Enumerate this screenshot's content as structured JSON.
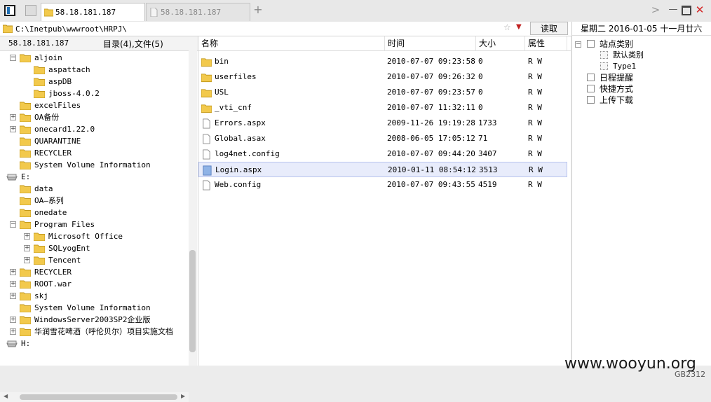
{
  "tabs": [
    {
      "label": "58.18.181.187",
      "active": true
    },
    {
      "label": "58.18.181.187",
      "active": false
    }
  ],
  "address": {
    "path": "C:\\Inetpub\\wwwroot\\HRPJ\\",
    "read_label": "读取",
    "star": "☆"
  },
  "left_header": {
    "host": "58.18.181.187",
    "summary": "目录(4),文件(5)"
  },
  "tree": [
    {
      "label": "aljoin",
      "level": 1,
      "exp": "-",
      "type": "folder"
    },
    {
      "label": "aspattach",
      "level": 2,
      "exp": "",
      "type": "folder"
    },
    {
      "label": "aspDB",
      "level": 2,
      "exp": "",
      "type": "folder"
    },
    {
      "label": "jboss-4.0.2",
      "level": 2,
      "exp": "",
      "type": "folder"
    },
    {
      "label": "excelFiles",
      "level": 1,
      "exp": "",
      "type": "folder"
    },
    {
      "label": "OA备份",
      "level": 1,
      "exp": "+",
      "type": "folder"
    },
    {
      "label": "onecard1.22.0",
      "level": 1,
      "exp": "+",
      "type": "folder"
    },
    {
      "label": "QUARANTINE",
      "level": 1,
      "exp": "",
      "type": "folder"
    },
    {
      "label": "RECYCLER",
      "level": 1,
      "exp": "",
      "type": "folder"
    },
    {
      "label": "System Volume Information",
      "level": 1,
      "exp": "",
      "type": "folder"
    },
    {
      "label": "E:",
      "level": 0,
      "exp": "",
      "type": "drive"
    },
    {
      "label": "data",
      "level": 1,
      "exp": "",
      "type": "folder"
    },
    {
      "label": "OA—系列",
      "level": 1,
      "exp": "",
      "type": "folder"
    },
    {
      "label": "onedate",
      "level": 1,
      "exp": "",
      "type": "folder"
    },
    {
      "label": "Program Files",
      "level": 1,
      "exp": "-",
      "type": "folder"
    },
    {
      "label": "Microsoft Office",
      "level": 2,
      "exp": "+",
      "type": "folder"
    },
    {
      "label": "SQLyogEnt",
      "level": 2,
      "exp": "+",
      "type": "folder"
    },
    {
      "label": "Tencent",
      "level": 2,
      "exp": "+",
      "type": "folder"
    },
    {
      "label": "RECYCLER",
      "level": 1,
      "exp": "+",
      "type": "folder"
    },
    {
      "label": "ROOT.war",
      "level": 1,
      "exp": "+",
      "type": "folder"
    },
    {
      "label": "skj",
      "level": 1,
      "exp": "+",
      "type": "folder"
    },
    {
      "label": "System Volume Information",
      "level": 1,
      "exp": "",
      "type": "folder"
    },
    {
      "label": "WindowsServer2003SP2企业版",
      "level": 1,
      "exp": "+",
      "type": "folder"
    },
    {
      "label": "华润雪花啤酒（呼伦贝尔）项目实施文档",
      "level": 1,
      "exp": "+",
      "type": "folder"
    },
    {
      "label": "H:",
      "level": 0,
      "exp": "",
      "type": "drive"
    }
  ],
  "columns": {
    "name": "名称",
    "time": "时间",
    "size": "大小",
    "attr": "属性"
  },
  "files": [
    {
      "name": "bin",
      "time": "2010-07-07 09:23:58",
      "size": "0",
      "attr": "R W",
      "type": "folder"
    },
    {
      "name": "userfiles",
      "time": "2010-07-07 09:26:32",
      "size": "0",
      "attr": "R W",
      "type": "folder"
    },
    {
      "name": "USL",
      "time": "2010-07-07 09:23:57",
      "size": "0",
      "attr": "R W",
      "type": "folder"
    },
    {
      "name": "_vti_cnf",
      "time": "2010-07-07 11:32:11",
      "size": "0",
      "attr": "R W",
      "type": "folder"
    },
    {
      "name": "Errors.aspx",
      "time": "2009-11-26 19:19:28",
      "size": "1733",
      "attr": "R W",
      "type": "file"
    },
    {
      "name": "Global.asax",
      "time": "2008-06-05 17:05:12",
      "size": "71",
      "attr": "R W",
      "type": "file"
    },
    {
      "name": "log4net.config",
      "time": "2010-07-07 09:44:20",
      "size": "3407",
      "attr": "R W",
      "type": "file"
    },
    {
      "name": "Login.aspx",
      "time": "2010-01-11 08:54:12",
      "size": "3513",
      "attr": "R W",
      "type": "file",
      "selected": true
    },
    {
      "name": "Web.config",
      "time": "2010-07-07 09:43:55",
      "size": "4519",
      "attr": "R W",
      "type": "file"
    }
  ],
  "right": {
    "date": "星期二  2016-01-05  十一月廿六",
    "items": [
      {
        "label": "站点类别",
        "level": 0,
        "exp": "-",
        "icon": "site-category-icon"
      },
      {
        "label": "默认类别",
        "level": 1,
        "exp": "",
        "icon": "category-icon"
      },
      {
        "label": "Type1",
        "level": 1,
        "exp": "",
        "icon": "category-icon"
      },
      {
        "label": "日程提醒",
        "level": 0,
        "exp": "",
        "icon": "schedule-icon"
      },
      {
        "label": "快捷方式",
        "level": 0,
        "exp": "",
        "icon": "shortcut-icon"
      },
      {
        "label": "上传下载",
        "level": 0,
        "exp": "",
        "icon": "transfer-icon"
      }
    ]
  },
  "watermark": "www.wooyun.org",
  "encoding": "GB2312",
  "colors": {
    "folder": "#f2c94c",
    "selection": "#e8ecfb"
  }
}
